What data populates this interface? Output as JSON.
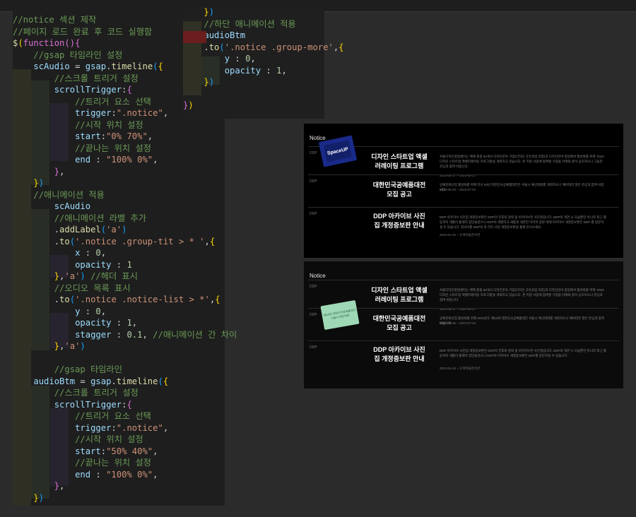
{
  "left_code": [
    [
      [
        "c",
        "//notice 섹션 제작"
      ]
    ],
    [
      [
        "c",
        "//페이지 로드 완료 후 코드 실행함"
      ]
    ],
    [
      [
        "f",
        "$"
      ],
      [
        "y",
        "("
      ],
      [
        "k",
        "function"
      ],
      [
        "k",
        "()"
      ],
      [
        "k",
        "{"
      ]
    ],
    [
      [
        "w",
        "    "
      ],
      [
        "c",
        "//gsap 타임라인 설정"
      ]
    ],
    [
      [
        "w",
        "    "
      ],
      [
        "v",
        "scAudio"
      ],
      [
        "p",
        " = "
      ],
      [
        "v",
        "gsap"
      ],
      [
        "p",
        "."
      ],
      [
        "f",
        "timeline"
      ],
      [
        "b",
        "("
      ],
      [
        "y",
        "{"
      ]
    ],
    [
      [
        "w",
        "        "
      ],
      [
        "c",
        "//스크롤 트리거 설정"
      ]
    ],
    [
      [
        "w",
        "        "
      ],
      [
        "v",
        "scrollTrigger"
      ],
      [
        "p",
        ":"
      ],
      [
        "k",
        "{"
      ]
    ],
    [
      [
        "w",
        "            "
      ],
      [
        "c",
        "//트리거 요소 선택"
      ]
    ],
    [
      [
        "w",
        "            "
      ],
      [
        "v",
        "trigger"
      ],
      [
        "p",
        ":"
      ],
      [
        "s",
        "\".notice\""
      ],
      [
        "p",
        ","
      ]
    ],
    [
      [
        "w",
        "            "
      ],
      [
        "c",
        "//시작 위치 설정"
      ]
    ],
    [
      [
        "w",
        "            "
      ],
      [
        "v",
        "start"
      ],
      [
        "p",
        ":"
      ],
      [
        "s",
        "\"0% 70%\""
      ],
      [
        "p",
        ","
      ]
    ],
    [
      [
        "w",
        "            "
      ],
      [
        "c",
        "//끝나는 위치 설정"
      ]
    ],
    [
      [
        "w",
        "            "
      ],
      [
        "v",
        "end"
      ],
      [
        "p",
        " : "
      ],
      [
        "s",
        "\"100% 0%\""
      ],
      [
        "p",
        ","
      ]
    ],
    [
      [
        "w",
        "        "
      ],
      [
        "k",
        "}"
      ],
      [
        "p",
        ","
      ]
    ],
    [
      [
        "w",
        "    "
      ],
      [
        "y",
        "}"
      ],
      [
        "b",
        ")"
      ]
    ],
    [
      [
        "w",
        "    "
      ],
      [
        "c",
        "//애니메이션 적용"
      ]
    ],
    [
      [
        "w",
        "        "
      ],
      [
        "v",
        "scAudio"
      ]
    ],
    [
      [
        "w",
        "        "
      ],
      [
        "c",
        "//애니메이션 라벨 추가"
      ]
    ],
    [
      [
        "w",
        "        "
      ],
      [
        "p",
        "."
      ],
      [
        "f",
        "addLabel"
      ],
      [
        "b",
        "("
      ],
      [
        "s",
        "'a'"
      ],
      [
        "b",
        ")"
      ]
    ],
    [
      [
        "w",
        "        "
      ],
      [
        "p",
        "."
      ],
      [
        "f",
        "to"
      ],
      [
        "b",
        "("
      ],
      [
        "s",
        "'.notice .group-tit > * '"
      ],
      [
        "p",
        ","
      ],
      [
        "y",
        "{"
      ]
    ],
    [
      [
        "w",
        "            "
      ],
      [
        "v",
        "x"
      ],
      [
        "p",
        " : "
      ],
      [
        "n",
        "0"
      ],
      [
        "p",
        ","
      ]
    ],
    [
      [
        "w",
        "            "
      ],
      [
        "v",
        "opacity"
      ],
      [
        "p",
        " : "
      ],
      [
        "n",
        "1"
      ]
    ],
    [
      [
        "w",
        "        "
      ],
      [
        "y",
        "}"
      ],
      [
        "p",
        ","
      ],
      [
        "s",
        "'a'"
      ],
      [
        "b",
        ")"
      ],
      [
        "p",
        " "
      ],
      [
        "c",
        "//헤더 표시"
      ]
    ],
    [
      [
        "w",
        "        "
      ],
      [
        "c",
        "//오디오 목록 표시"
      ]
    ],
    [
      [
        "w",
        "        "
      ],
      [
        "p",
        "."
      ],
      [
        "f",
        "to"
      ],
      [
        "b",
        "("
      ],
      [
        "s",
        "'.notice .notice-list > *'"
      ],
      [
        "p",
        ","
      ],
      [
        "y",
        "{"
      ]
    ],
    [
      [
        "w",
        "            "
      ],
      [
        "v",
        "y"
      ],
      [
        "p",
        " : "
      ],
      [
        "n",
        "0"
      ],
      [
        "p",
        ","
      ]
    ],
    [
      [
        "w",
        "            "
      ],
      [
        "v",
        "opacity"
      ],
      [
        "p",
        " : "
      ],
      [
        "n",
        "1"
      ],
      [
        "p",
        ","
      ]
    ],
    [
      [
        "w",
        "            "
      ],
      [
        "v",
        "stagger"
      ],
      [
        "p",
        " : "
      ],
      [
        "n",
        "0.1"
      ],
      [
        "p",
        ", "
      ],
      [
        "c",
        "//애니메이션 간 차이"
      ]
    ],
    [
      [
        "w",
        "        "
      ],
      [
        "y",
        "}"
      ],
      [
        "p",
        ","
      ],
      [
        "s",
        "'a'"
      ],
      [
        "b",
        ")"
      ]
    ],
    [
      [
        "w",
        " "
      ]
    ],
    [
      [
        "w",
        "        "
      ],
      [
        "c",
        "//gsap 타임라인"
      ]
    ],
    [
      [
        "w",
        "    "
      ],
      [
        "v",
        "audioBtm"
      ],
      [
        "p",
        " = "
      ],
      [
        "v",
        "gsap"
      ],
      [
        "p",
        "."
      ],
      [
        "f",
        "timeline"
      ],
      [
        "b",
        "("
      ],
      [
        "y",
        "{"
      ]
    ],
    [
      [
        "w",
        "        "
      ],
      [
        "c",
        "//스크롤 트리거 설정"
      ]
    ],
    [
      [
        "w",
        "        "
      ],
      [
        "v",
        "scrollTrigger"
      ],
      [
        "p",
        ":"
      ],
      [
        "k",
        "{"
      ]
    ],
    [
      [
        "w",
        "            "
      ],
      [
        "c",
        "//트리거 요소 선택"
      ]
    ],
    [
      [
        "w",
        "            "
      ],
      [
        "v",
        "trigger"
      ],
      [
        "p",
        ":"
      ],
      [
        "s",
        "\".notice\""
      ],
      [
        "p",
        ","
      ]
    ],
    [
      [
        "w",
        "            "
      ],
      [
        "c",
        "//시작 위치 설정"
      ]
    ],
    [
      [
        "w",
        "            "
      ],
      [
        "v",
        "start"
      ],
      [
        "p",
        ":"
      ],
      [
        "s",
        "\"50% 40%\""
      ],
      [
        "p",
        ","
      ]
    ],
    [
      [
        "w",
        "            "
      ],
      [
        "c",
        "//끝나는 위치 설정"
      ]
    ],
    [
      [
        "w",
        "            "
      ],
      [
        "v",
        "end"
      ],
      [
        "p",
        " : "
      ],
      [
        "s",
        "\"100% 0%\""
      ],
      [
        "p",
        ","
      ]
    ],
    [
      [
        "w",
        "        "
      ],
      [
        "k",
        "}"
      ],
      [
        "p",
        ","
      ]
    ],
    [
      [
        "w",
        "    "
      ],
      [
        "y",
        "}"
      ],
      [
        "b",
        ")"
      ]
    ]
  ],
  "right_code": [
    [
      [
        "w",
        "    "
      ],
      [
        "y",
        "}"
      ],
      [
        "b",
        ")"
      ]
    ],
    [
      [
        "w",
        "    "
      ],
      [
        "c",
        "//하단 애니메이션 적용"
      ]
    ],
    [
      [
        "w",
        "    "
      ],
      [
        "v",
        "audioBtm"
      ]
    ],
    [
      [
        "w",
        "    "
      ],
      [
        "p",
        "."
      ],
      [
        "f",
        "to"
      ],
      [
        "b",
        "("
      ],
      [
        "s",
        "'.notice .group-more'"
      ],
      [
        "p",
        ","
      ],
      [
        "y",
        "{"
      ]
    ],
    [
      [
        "w",
        "        "
      ],
      [
        "v",
        "y"
      ],
      [
        "p",
        " : "
      ],
      [
        "n",
        "0"
      ],
      [
        "p",
        ","
      ]
    ],
    [
      [
        "w",
        "        "
      ],
      [
        "v",
        "opacity"
      ],
      [
        "p",
        " : "
      ],
      [
        "n",
        "1"
      ],
      [
        "p",
        ","
      ]
    ],
    [
      [
        "w",
        "    "
      ],
      [
        "y",
        "}"
      ],
      [
        "b",
        ")"
      ]
    ],
    [
      [
        "w",
        " "
      ]
    ],
    [
      [
        "k",
        "}"
      ],
      [
        "y",
        ")"
      ]
    ]
  ],
  "panel1": {
    "title": "Notice",
    "items": [
      {
        "tag": "DDP",
        "title": "디자인 스타트업 액셀\n러레이팅 프로그램",
        "desc": "서울디자인창업센터는 매해 총합 50개사 디자인분야 기업(디자인 고유성업 포함)과 디자인분야 창업에서 활성화를 위해 '2023 디자인 스타트업 액셀러레이팅 프로그램'을 개최하고 있습니다. 본 지원 사업에 참여할 기업을 아래와 같이 공모하오니 그들한 관심과 참여 바랍니다.",
        "date": "2023-05-17 ~ 2023-06-17",
        "thumb": "SpaceUP"
      },
      {
        "tag": "DDP",
        "title": "대한민국공예품대전\n모집 공고",
        "desc": "공예문화산업 활성화를 위해 지난 53년 대한민국공예품대전은 서울시 예선대회를 개최하오니 예비대전 많은 관심과 참여 바랍니다.",
        "date": "2023-06-26 ~ 2023-07-04",
        "thumb": ""
      },
      {
        "tag": "DDP",
        "title": "DDP 아카이브 사진\n집 개정증보판 안내",
        "desc": "DDP 아카이브 사진집 개정증보판은 DDP의 전후와 정략 을 아카이브한 사진첩입니다. DDP의 개관 시 모습뿐만 아니라 최근 활동까지 개졸이 통해지 집만들었으니 DDP의 개별하고 새롭게 개관된 이미지 원본 대해 아카이브 개정증보판은 DDP 를 방문하실 수 있습니다. 외국어를 DDP의 학 리티 사업 개정증보판을 통해 만나보세요.",
        "date": "2023-01-26 ~ 유개박물관서관",
        "thumb": ""
      }
    ]
  },
  "panel2": {
    "title": "Notice",
    "items": [
      {
        "tag": "DDP",
        "title": "디자인 스타트업 액셀\n러레이팅 프로그램",
        "desc": "서울디자인창업센터는 매해 총합 50개사 디자인분야 기업(디자인 고유성업 포함)과 디자인분야 창업에서 활성화를 위해 '2023 디자인 스타트업 액셀러레이팅 프로그램'을 개최하고 있습니다. 본 지원 사업에 참여할 기업을 아래와 같이 공모하오니 관심과 참여 바랍니다.",
        "date": "2023-05-17 ~ 2023-06-17",
        "thumb": ""
      },
      {
        "tag": "DDP",
        "title": "대한민국공예품대전\n모집 공고",
        "desc": "공예문화산업 활성화를 위해 2023년도 제54회 대한민국공예품대전 서울시 예선대회를 개최하오니 예비대전 많은 관심과 참여 바랍니다.",
        "date": "2023-06-26 ~ 2023-07-04",
        "thumb": "제54회 대한민국공예품대전 서울시 예선대회"
      },
      {
        "tag": "DDP",
        "title": "DDP 아카이브 사진\n집 개정증보판 안내",
        "desc": "DDP 아카이브 사진집 개정증보판은 DDP의 전후와 정략 을 아카이브한 사진첩입니다. DDP의 개관 시 모습뿐만 아니라 최근 활동까지 개졸이 통해지 집만들었으니 DDP의 아카이브 개정증보판은 DDP를 방문하실 수 있습니다.",
        "date": "2023-01-26 ~ 유개박물관서관",
        "thumb": ""
      }
    ]
  }
}
